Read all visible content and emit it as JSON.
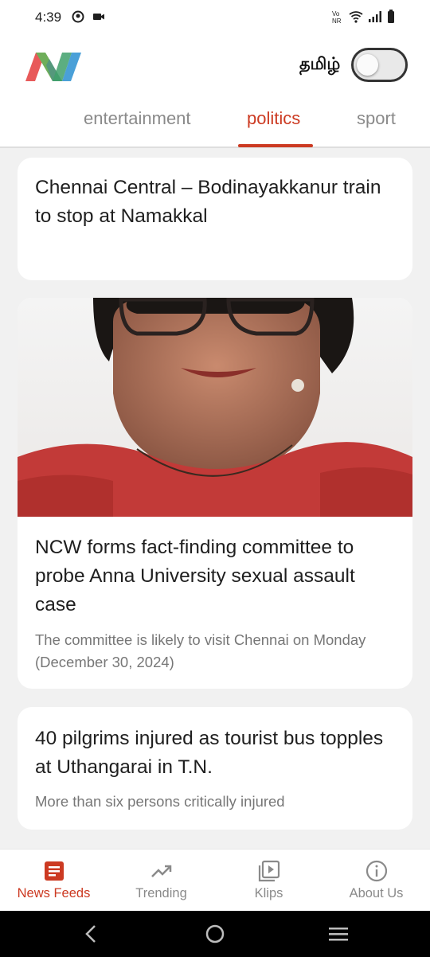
{
  "status_bar": {
    "time": "4:39",
    "left_icons": [
      "notification-circle-icon",
      "video-recorder-icon"
    ],
    "right_icons": [
      "vonr-icon",
      "wifi-icon",
      "signal-icon",
      "battery-icon"
    ],
    "vonr_top": "Vo",
    "vonr_bottom": "NR"
  },
  "header": {
    "logo": "app-logo-n",
    "language_label": "தமிழ்",
    "language_toggle_on": false
  },
  "tabs": {
    "items": [
      {
        "label": "entertainment",
        "active": false
      },
      {
        "label": "politics",
        "active": true
      },
      {
        "label": "sport",
        "active": false
      }
    ],
    "accent_color": "#cc3a22"
  },
  "articles": [
    {
      "title": "Chennai Central – Bodinayakkanur train to stop at Namakkal",
      "subtitle": ""
    },
    {
      "title": "NCW forms fact-finding committee to probe Anna University sexual assault case",
      "subtitle": "The committee is likely to visit Chennai on Monday (December 30, 2024)",
      "image": "woman-portrait-photo"
    },
    {
      "title": "40 pilgrims injured as tourist bus topples at Uthangarai in T.N.",
      "subtitle": "More than six persons critically injured"
    }
  ],
  "bottom_nav": {
    "items": [
      {
        "label": "News Feeds",
        "icon": "news-feed-icon",
        "active": true
      },
      {
        "label": "Trending",
        "icon": "trending-icon",
        "active": false
      },
      {
        "label": "Klips",
        "icon": "klips-video-icon",
        "active": false
      },
      {
        "label": "About Us",
        "icon": "info-icon",
        "active": false
      }
    ]
  },
  "system_nav": [
    "back-icon",
    "home-icon",
    "recents-icon"
  ]
}
